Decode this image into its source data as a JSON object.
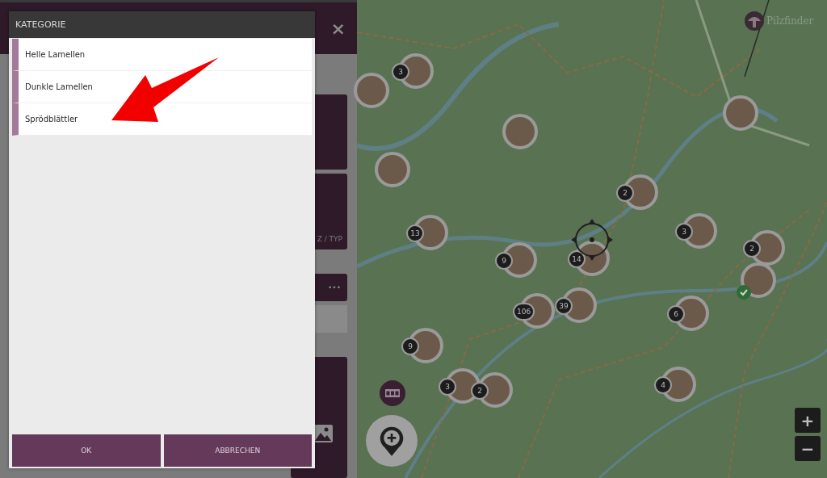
{
  "background_panel": {
    "close": "×",
    "card_text": "Z / TYP",
    "more": "•••"
  },
  "dialog": {
    "title": "KATEGORIE",
    "items": [
      {
        "label": "Helle Lamellen",
        "selected": false
      },
      {
        "label": "Dunkle Lamellen",
        "selected": false
      },
      {
        "label": "Sprödblättler",
        "selected": false
      }
    ],
    "buttons": [
      "OK",
      "ABBRECHEN"
    ]
  },
  "map": {
    "logo": "Pilzfinder",
    "markers": [
      {
        "kind": "photo",
        "checked": false
      },
      {
        "kind": "cluster",
        "count": "3",
        "checked": false
      },
      {
        "kind": "photo",
        "checked": false
      },
      {
        "kind": "photo",
        "checked": false
      },
      {
        "kind": "cluster",
        "count": "2",
        "checked": false
      },
      {
        "kind": "photo",
        "checked": false
      },
      {
        "kind": "cluster",
        "count": "13",
        "checked": false
      },
      {
        "kind": "cluster",
        "count": "3",
        "checked": false
      },
      {
        "kind": "cluster",
        "count": "2",
        "checked": false
      },
      {
        "kind": "cluster",
        "count": "9",
        "checked": false
      },
      {
        "kind": "cluster",
        "count": "14",
        "checked": false
      },
      {
        "kind": "photo",
        "checked": true
      },
      {
        "kind": "cluster",
        "count": "106",
        "checked": false
      },
      {
        "kind": "cluster",
        "count": "39",
        "checked": false
      },
      {
        "kind": "cluster",
        "count": "6",
        "checked": false
      },
      {
        "kind": "cluster",
        "count": "9",
        "checked": false
      },
      {
        "kind": "cluster",
        "count": "3",
        "checked": false
      },
      {
        "kind": "cluster",
        "count": "2",
        "checked": false
      },
      {
        "kind": "cluster",
        "count": "4",
        "checked": false
      }
    ],
    "zoom": [
      "+",
      "−"
    ]
  }
}
